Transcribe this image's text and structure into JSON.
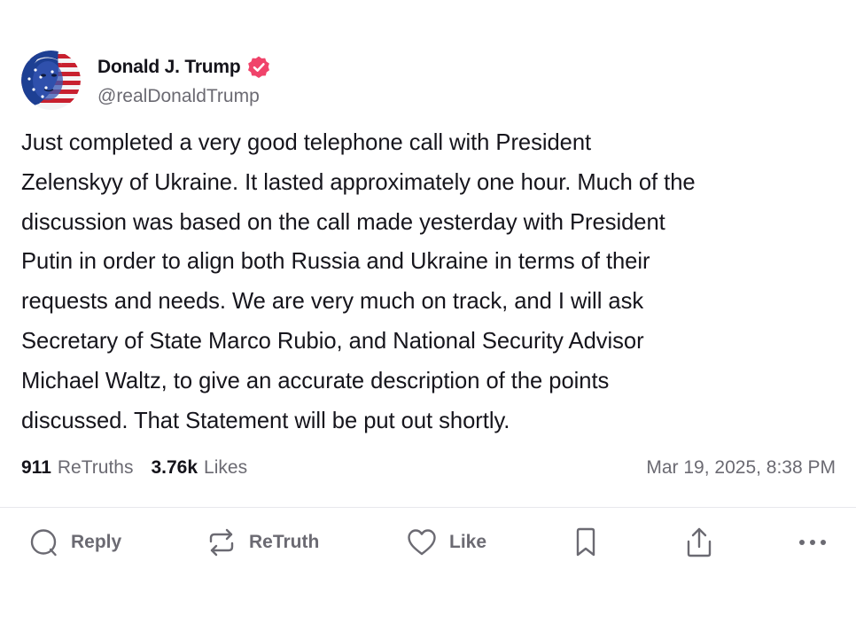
{
  "author": {
    "display_name": "Donald J. Trump",
    "handle": "@realDonaldTrump",
    "verified_color": "#f0436a"
  },
  "post": {
    "text": "Just completed a very good telephone call with President\nZelenskyy of Ukraine. It lasted approximately one hour. Much of the\ndiscussion was based on the call made yesterday with President\nPutin in order to align both Russia and Ukraine in terms of their\nrequests and needs. We are very much on track, and I will ask\nSecretary of State Marco Rubio, and National Security Advisor\nMichael Waltz, to give an accurate description of the points\ndiscussed. That Statement will be put out shortly."
  },
  "stats": {
    "retruths_count": "911",
    "retruths_label": "ReTruths",
    "likes_count": "3.76k",
    "likes_label": "Likes",
    "timestamp": "Mar 19, 2025, 8:38 PM"
  },
  "actions": {
    "reply_label": "Reply",
    "retruth_label": "ReTruth",
    "like_label": "Like",
    "icons": [
      "reply-icon",
      "retruth-icon",
      "like-icon",
      "bookmark-icon",
      "share-icon",
      "more-icon"
    ]
  }
}
